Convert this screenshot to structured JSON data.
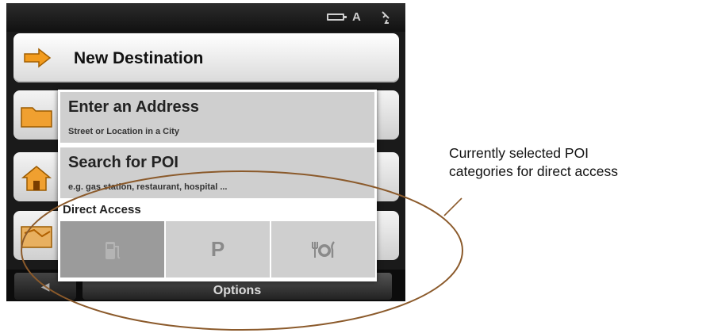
{
  "popup": {
    "items": [
      {
        "title": "Enter an Address",
        "subtitle": "Street or Location in a City"
      },
      {
        "title": "Search for POI",
        "subtitle": "e.g. gas station, restaurant, hospital ..."
      }
    ],
    "direct_access_label": "Direct Access",
    "direct_access_tiles": [
      {
        "icon": "fuel-pump-icon",
        "selected": true
      },
      {
        "icon": "parking-icon",
        "glyph": "P",
        "selected": false
      },
      {
        "icon": "restaurant-icon",
        "selected": false
      }
    ]
  },
  "main_menu": {
    "new_destination_label": "New Destination",
    "side_button_icons": [
      "folder-icon",
      "home-icon",
      "map-icon"
    ]
  },
  "bottom_bar": {
    "back_glyph": "◀",
    "options_label": "Options"
  },
  "annotation": {
    "line1": "Currently selected POI",
    "line2": "categories for direct access"
  },
  "colors": {
    "annotation_ellipse": "#8b5a2b",
    "arrow_orange": "#f29b1d",
    "selected_tile": "#9b9b9b",
    "tile": "#cfcfcf"
  }
}
